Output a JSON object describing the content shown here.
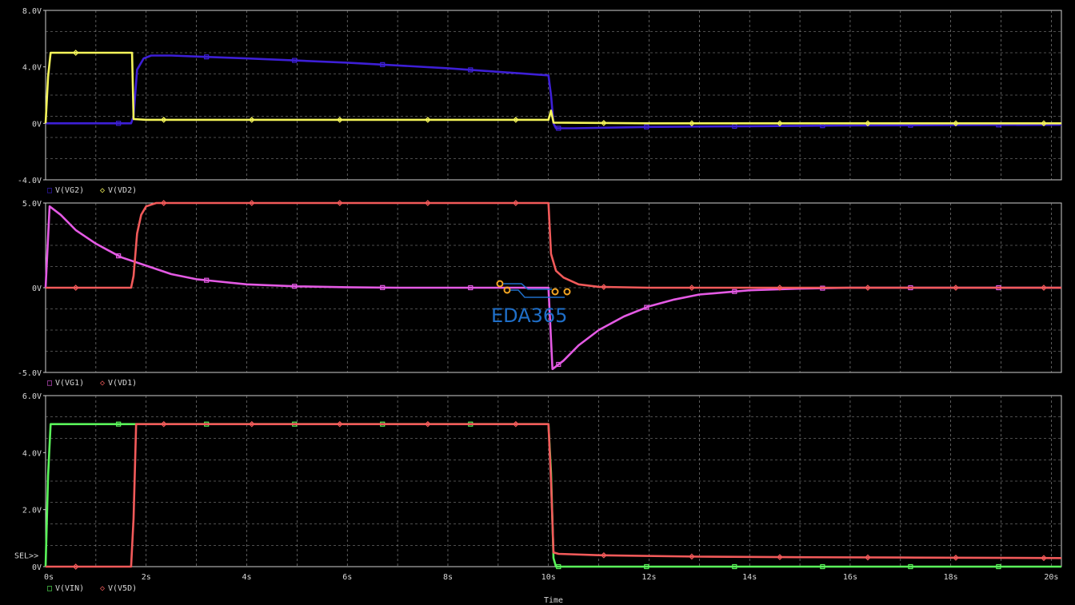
{
  "watermark": {
    "text": "EDA365"
  },
  "chart_data": {
    "type": "line",
    "xlabel": "Time",
    "x_range": [
      0,
      20.2
    ],
    "x_ticks": [
      "0s",
      "2s",
      "4s",
      "6s",
      "8s",
      "10s",
      "12s",
      "14s",
      "16s",
      "18s",
      "20s"
    ],
    "x_tick_values": [
      0,
      2,
      4,
      6,
      8,
      10,
      12,
      14,
      16,
      18,
      20
    ],
    "grid": true,
    "panels": [
      {
        "id": "top",
        "ylim": [
          -4,
          8
        ],
        "y_ticks": [
          "8.0V",
          "4.0V",
          "0V",
          "-4.0V"
        ],
        "y_tick_values": [
          8,
          4,
          0,
          -4
        ],
        "legend": [
          {
            "marker": "□",
            "name": "V(VG2)",
            "color": "#3d1fd6"
          },
          {
            "marker": "◇",
            "name": "V(VD2)",
            "color": "#f5f55a"
          }
        ],
        "series": [
          {
            "name": "V(VG2)",
            "color": "#3d1fd6",
            "marker": "square",
            "points": [
              [
                0,
                0
              ],
              [
                1.5,
                0
              ],
              [
                1.7,
                0
              ],
              [
                1.75,
                0.5
              ],
              [
                1.82,
                3.8
              ],
              [
                1.95,
                4.6
              ],
              [
                2.1,
                4.8
              ],
              [
                2.5,
                4.8
              ],
              [
                4,
                4.6
              ],
              [
                6,
                4.3
              ],
              [
                8,
                3.9
              ],
              [
                10,
                3.4
              ],
              [
                10.05,
                2.0
              ],
              [
                10.1,
                0
              ],
              [
                10.15,
                -0.35
              ],
              [
                10.5,
                -0.35
              ],
              [
                12,
                -0.25
              ],
              [
                14,
                -0.2
              ],
              [
                16,
                -0.15
              ],
              [
                18,
                -0.12
              ],
              [
                20.2,
                -0.1
              ]
            ]
          },
          {
            "name": "V(VD2)",
            "color": "#f5f55a",
            "marker": "diamond",
            "points": [
              [
                0,
                0
              ],
              [
                0.05,
                3.3
              ],
              [
                0.1,
                5
              ],
              [
                1.72,
                5
              ],
              [
                1.75,
                0.3
              ],
              [
                2,
                0.25
              ],
              [
                4,
                0.25
              ],
              [
                6,
                0.25
              ],
              [
                8,
                0.25
              ],
              [
                10,
                0.25
              ],
              [
                10.05,
                0.9
              ],
              [
                10.1,
                0.05
              ],
              [
                12,
                0
              ],
              [
                14,
                0
              ],
              [
                16,
                0
              ],
              [
                18,
                0
              ],
              [
                20.2,
                0
              ]
            ]
          }
        ]
      },
      {
        "id": "middle",
        "ylim": [
          -5,
          5
        ],
        "y_ticks": [
          "5.0V",
          "0V",
          "-5.0V"
        ],
        "y_tick_values": [
          5,
          0,
          -5
        ],
        "legend": [
          {
            "marker": "□",
            "name": "V(VG1)",
            "color": "#e45ae4"
          },
          {
            "marker": "◇",
            "name": "V(VD1)",
            "color": "#f25a5a"
          }
        ],
        "series": [
          {
            "name": "V(VG1)",
            "color": "#e45ae4",
            "marker": "square",
            "points": [
              [
                0,
                0
              ],
              [
                0.08,
                4.8
              ],
              [
                0.3,
                4.3
              ],
              [
                0.6,
                3.4
              ],
              [
                1,
                2.6
              ],
              [
                1.5,
                1.8
              ],
              [
                2,
                1.3
              ],
              [
                2.5,
                0.8
              ],
              [
                3,
                0.5
              ],
              [
                4,
                0.2
              ],
              [
                5,
                0.08
              ],
              [
                6,
                0.03
              ],
              [
                7,
                0
              ],
              [
                8,
                0
              ],
              [
                9,
                0
              ],
              [
                10,
                0
              ],
              [
                10.08,
                -4.8
              ],
              [
                10.3,
                -4.3
              ],
              [
                10.6,
                -3.4
              ],
              [
                11,
                -2.5
              ],
              [
                11.5,
                -1.7
              ],
              [
                12,
                -1.1
              ],
              [
                12.5,
                -0.7
              ],
              [
                13,
                -0.4
              ],
              [
                14,
                -0.15
              ],
              [
                15,
                -0.05
              ],
              [
                16,
                0
              ],
              [
                18,
                0
              ],
              [
                20.2,
                0
              ]
            ]
          },
          {
            "name": "V(VD1)",
            "color": "#f25a5a",
            "marker": "diamond",
            "points": [
              [
                0,
                0
              ],
              [
                1.7,
                0
              ],
              [
                1.75,
                0.7
              ],
              [
                1.82,
                3.2
              ],
              [
                1.9,
                4.3
              ],
              [
                2,
                4.8
              ],
              [
                2.2,
                5
              ],
              [
                4,
                5
              ],
              [
                6,
                5
              ],
              [
                8,
                5
              ],
              [
                10,
                5
              ],
              [
                10.05,
                2.0
              ],
              [
                10.15,
                1.0
              ],
              [
                10.3,
                0.6
              ],
              [
                10.6,
                0.2
              ],
              [
                11,
                0.05
              ],
              [
                12,
                0
              ],
              [
                14,
                0
              ],
              [
                16,
                0
              ],
              [
                18,
                0
              ],
              [
                20.2,
                0
              ]
            ]
          }
        ]
      },
      {
        "id": "bottom",
        "ylim": [
          0,
          6
        ],
        "y_ticks": [
          "6.0V",
          "4.0V",
          "2.0V",
          "0V"
        ],
        "y_tick_values": [
          6,
          4,
          2,
          0
        ],
        "sel_label": "SEL>>",
        "legend": [
          {
            "marker": "□",
            "name": "V(VIN)",
            "color": "#5af55a"
          },
          {
            "marker": "◇",
            "name": "V(V5D)",
            "color": "#f25a5a"
          }
        ],
        "series": [
          {
            "name": "V(VIN)",
            "color": "#5af55a",
            "marker": "square",
            "points": [
              [
                0,
                0
              ],
              [
                0.05,
                3.2
              ],
              [
                0.1,
                5
              ],
              [
                2,
                5
              ],
              [
                4,
                5
              ],
              [
                6,
                5
              ],
              [
                8,
                5
              ],
              [
                10,
                5
              ],
              [
                10.05,
                3.3
              ],
              [
                10.1,
                0.3
              ],
              [
                10.15,
                0
              ],
              [
                12,
                0
              ],
              [
                14,
                0
              ],
              [
                16,
                0
              ],
              [
                18,
                0
              ],
              [
                20.2,
                0
              ]
            ]
          },
          {
            "name": "V(V5D)",
            "color": "#f25a5a",
            "marker": "diamond",
            "points": [
              [
                0,
                0
              ],
              [
                1.7,
                0
              ],
              [
                1.75,
                1.7
              ],
              [
                1.8,
                5
              ],
              [
                2,
                5
              ],
              [
                4,
                5
              ],
              [
                6,
                5
              ],
              [
                8,
                5
              ],
              [
                10,
                5
              ],
              [
                10.05,
                3.0
              ],
              [
                10.1,
                0.5
              ],
              [
                10.2,
                0.45
              ],
              [
                11,
                0.4
              ],
              [
                13,
                0.35
              ],
              [
                15,
                0.33
              ],
              [
                17,
                0.32
              ],
              [
                20.2,
                0.3
              ]
            ]
          }
        ]
      }
    ]
  }
}
